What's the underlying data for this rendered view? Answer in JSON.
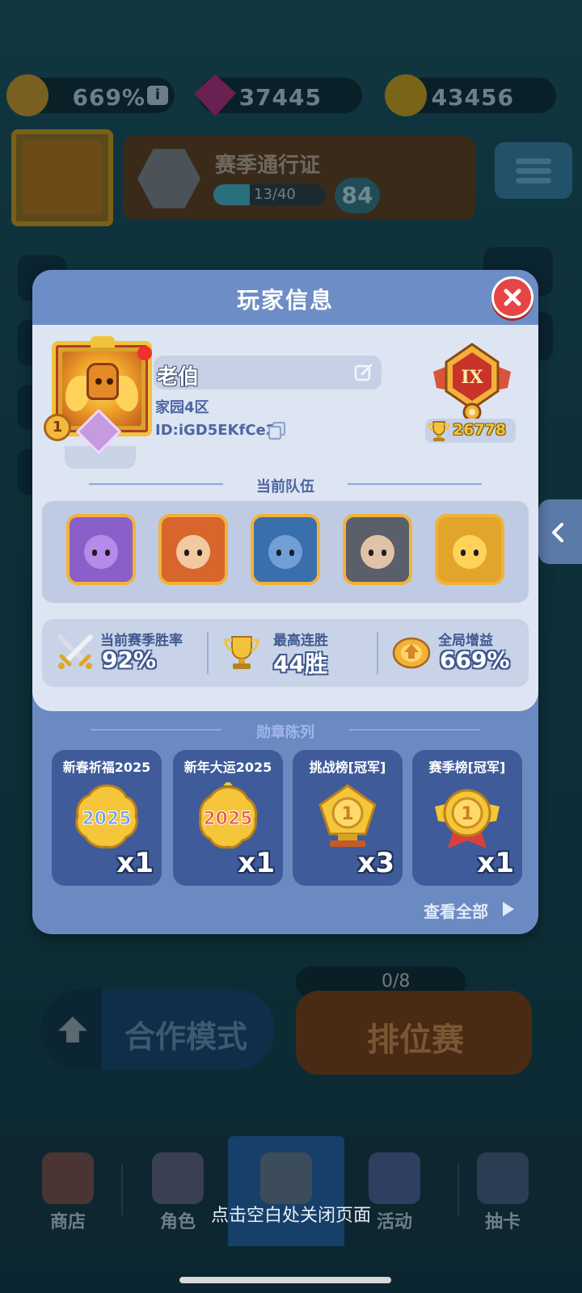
{
  "top_bar": {
    "global_bonus": "669%",
    "info_label": "i",
    "gems": "37445",
    "coins": "43456"
  },
  "season_pass": {
    "title": "赛季通行证",
    "progress_text": "13/40",
    "progress_fraction": 0.325,
    "level": "84"
  },
  "modes": {
    "rank_wins": "0/8",
    "coop_label": "合作模式",
    "ranked_label": "排位赛"
  },
  "bottom_nav": {
    "items": [
      {
        "label": "商店",
        "icon": "shop-icon"
      },
      {
        "label": "角色",
        "icon": "character-icon"
      },
      {
        "label": "",
        "icon": "battle-icon"
      },
      {
        "label": "活动",
        "icon": "event-star-icon"
      },
      {
        "label": "抽卡",
        "icon": "card-draw-icon"
      }
    ],
    "active_index": 2
  },
  "close_hint": "点击空白处关闭页面",
  "modal": {
    "title": "玩家信息",
    "player": {
      "name": "老伯",
      "server": "家园4区",
      "id": "ID:iGD5EKfCe2",
      "avatar_badge": "1",
      "rank_numeral": "IX",
      "trophies": "26778"
    },
    "team": {
      "title": "当前队伍",
      "heroes": [
        {
          "color": "#8b5fc9",
          "face": "#b58ae8"
        },
        {
          "color": "#d8652c",
          "face": "#f3c9a0"
        },
        {
          "color": "#3a6fae",
          "face": "#6f9fd6"
        },
        {
          "color": "#5a5f6a",
          "face": "#e0c2a6"
        },
        {
          "color": "#e0a52a",
          "face": "#ffd35a"
        }
      ]
    },
    "stats": [
      {
        "label": "当前赛季胜率",
        "value": "92%",
        "icon": "crossed-swords-icon"
      },
      {
        "label": "最高连胜",
        "value": "44胜",
        "icon": "trophy-icon"
      },
      {
        "label": "全局增益",
        "value": "669%",
        "icon": "bonus-badge-icon"
      }
    ],
    "medals": {
      "title": "勋章陈列",
      "items": [
        {
          "name": "新春祈福2025",
          "count": "x1",
          "icon": "new-year-blessing-medal-icon",
          "text": "2025"
        },
        {
          "name": "新年大运2025",
          "count": "x1",
          "icon": "new-year-fortune-medal-icon",
          "text": "2025"
        },
        {
          "name": "挑战榜[冠军]",
          "count": "x3",
          "icon": "challenge-champion-medal-icon",
          "text": "1"
        },
        {
          "name": "赛季榜[冠军]",
          "count": "x1",
          "icon": "season-champion-medal-icon",
          "text": "1"
        }
      ],
      "view_all": "查看全部"
    }
  },
  "colors": {
    "modal_blue": "#6b8ac2",
    "panel_light": "#dde5f3",
    "close_red": "#e64545",
    "gold": "#f2c33a",
    "text_blue": "#4d66a3"
  }
}
